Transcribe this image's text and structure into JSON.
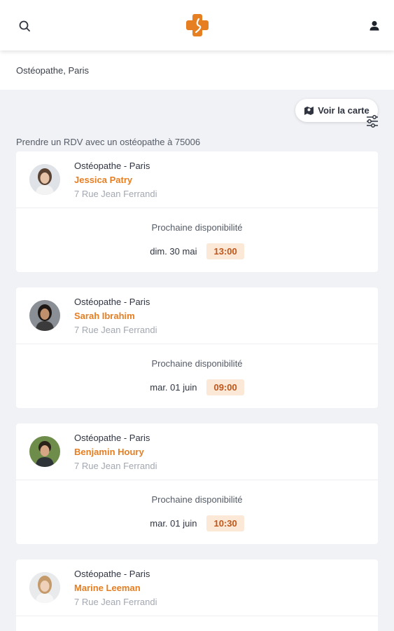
{
  "header": {
    "search_icon": "search-icon",
    "logo_icon": "medical-cross-logo",
    "account_icon": "user-icon",
    "brand_color": "#e67e22"
  },
  "search": {
    "query": "Ostéopathe, Paris",
    "filters_icon": "sliders-icon"
  },
  "map_button": {
    "label": "Voir la carte",
    "icon": "map-icon"
  },
  "intro": "Prendre un RDV avec un ostéopathe à 75006",
  "availability_label": "Prochaine disponibilité",
  "practitioners": [
    {
      "specialty": "Ostéopathe - Paris",
      "name": "Jessica Patry",
      "address": "7 Rue Jean Ferrandi",
      "date": "dim. 30 mai",
      "time": "13:00"
    },
    {
      "specialty": "Ostéopathe - Paris",
      "name": "Sarah Ibrahim",
      "address": "7 Rue Jean Ferrandi",
      "date": "mar. 01 juin",
      "time": "09:00"
    },
    {
      "specialty": "Ostéopathe - Paris",
      "name": "Benjamin Houry",
      "address": "7 Rue Jean Ferrandi",
      "date": "mar. 01 juin",
      "time": "10:30"
    },
    {
      "specialty": "Ostéopathe - Paris",
      "name": "Marine Leeman",
      "address": "7 Rue Jean Ferrandi"
    }
  ]
}
